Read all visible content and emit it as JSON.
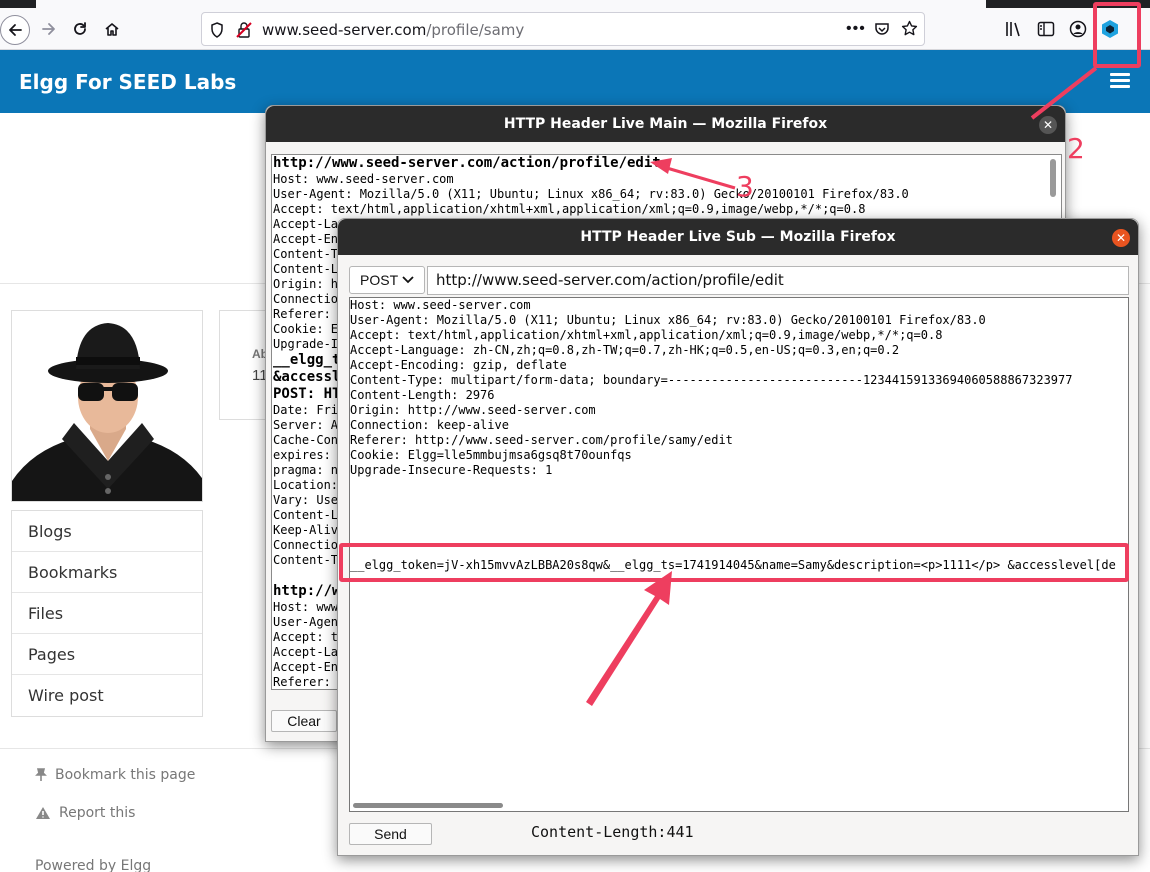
{
  "browser": {
    "url_host": "www.seed-server.com",
    "url_path": "/profile/samy",
    "icons": [
      "back-icon",
      "forward-icon",
      "reload-icon",
      "home-icon",
      "shield-icon",
      "insecure-lock-icon",
      "more-icon",
      "pocket-icon",
      "bookmark-star-icon",
      "library-icon",
      "sidebar-icon",
      "account-icon",
      "http-header-live-icon",
      "app-menu-icon"
    ]
  },
  "elgg": {
    "site_name": "Elgg For SEED Labs",
    "about_label": "Ab",
    "about_value": "11",
    "menu": [
      "Blogs",
      "Bookmarks",
      "Files",
      "Pages",
      "Wire post"
    ],
    "footer": {
      "bookmark": "Bookmark this page",
      "report": "Report this",
      "powered": "Powered by Elgg"
    }
  },
  "main_window": {
    "title": "HTTP Header Live Main — Mozilla Firefox",
    "clear_label": "Clear",
    "log": [
      {
        "text": "http://www.seed-server.com/action/profile/edit",
        "bold": true
      },
      {
        "text": "Host: www.seed-server.com"
      },
      {
        "text": "User-Agent: Mozilla/5.0 (X11; Ubuntu; Linux x86_64; rv:83.0) Gecko/20100101 Firefox/83.0"
      },
      {
        "text": "Accept: text/html,application/xhtml+xml,application/xml;q=0.9,image/webp,*/*;q=0.8"
      },
      {
        "text": "Accept-La"
      },
      {
        "text": "Accept-En"
      },
      {
        "text": "Content-T"
      },
      {
        "text": "Content-L"
      },
      {
        "text": "Origin: h"
      },
      {
        "text": "Connectio"
      },
      {
        "text": "Referer: "
      },
      {
        "text": "Cookie: E"
      },
      {
        "text": "Upgrade-I"
      },
      {
        "text": "__elgg_t",
        "bold": true
      },
      {
        "text": "&accessl",
        "bold": true
      },
      {
        "text": "POST: HT",
        "bold": true
      },
      {
        "text": "Date: Fri"
      },
      {
        "text": "Server: A"
      },
      {
        "text": "Cache-Con"
      },
      {
        "text": "expires: "
      },
      {
        "text": "pragma: n"
      },
      {
        "text": "Location:"
      },
      {
        "text": "Vary: Use"
      },
      {
        "text": "Content-L"
      },
      {
        "text": "Keep-Aliv"
      },
      {
        "text": "Connectio"
      },
      {
        "text": "Content-T"
      },
      {
        "text": ""
      },
      {
        "text": "http://w",
        "bold": true
      },
      {
        "text": "Host: www"
      },
      {
        "text": "User-Agen"
      },
      {
        "text": "Accept: t"
      },
      {
        "text": "Accept-La"
      },
      {
        "text": "Accept-En"
      },
      {
        "text": "Referer: "
      }
    ]
  },
  "sub_window": {
    "title": "HTTP Header Live Sub — Mozilla Firefox",
    "method": "POST",
    "url": "http://www.seed-server.com/action/profile/edit",
    "headers": [
      "Host: www.seed-server.com",
      "User-Agent: Mozilla/5.0 (X11; Ubuntu; Linux x86_64; rv:83.0) Gecko/20100101 Firefox/83.0",
      "Accept: text/html,application/xhtml+xml,application/xml;q=0.9,image/webp,*/*;q=0.8",
      "Accept-Language: zh-CN,zh;q=0.8,zh-TW;q=0.7,zh-HK;q=0.5,en-US;q=0.3,en;q=0.2",
      "Accept-Encoding: gzip, deflate",
      "Content-Type: multipart/form-data; boundary=---------------------------12344159133694060588867323977",
      "Content-Length: 2976",
      "Origin: http://www.seed-server.com",
      "Connection: keep-alive",
      "Referer: http://www.seed-server.com/profile/samy/edit",
      "Cookie: Elgg=lle5mmbujmsa6gsq8t70ounfqs",
      "Upgrade-Insecure-Requests: 1"
    ],
    "body": "__elgg_token=jV-xh15mvvAzLBBA20s8qw&__elgg_ts=1741914045&name=Samy&description=<p>1111</p> &accesslevel[de",
    "send_label": "Send",
    "content_length": "Content-Length:441"
  },
  "annotations": {
    "label_2": "2",
    "label_3": "3",
    "color": "#ee3e5f"
  }
}
